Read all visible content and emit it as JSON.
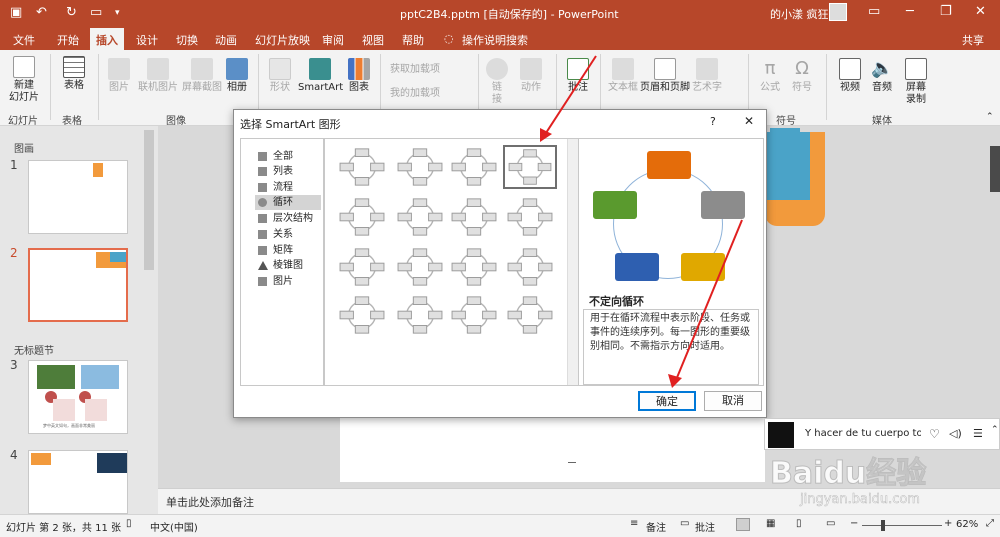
{
  "window": {
    "title": "pptC2B4.pptm [自动保存的] - PowerPoint",
    "user": "的小漾 疯狂",
    "share": "共享"
  },
  "tabs": [
    "文件",
    "开始",
    "插入",
    "设计",
    "切换",
    "动画",
    "幻灯片放映",
    "审阅",
    "视图",
    "帮助"
  ],
  "active_tab": "插入",
  "tell_me": "操作说明搜索",
  "ribbon": {
    "new_slide": [
      "新建",
      "幻灯片"
    ],
    "table": "表格",
    "picture": "图片",
    "online_picture": "联机图片",
    "screenshot": "屏幕截图",
    "album": "相册",
    "shapes": "形状",
    "smartart": "SmartArt",
    "chart": "图表",
    "get_addins": "获取加载项",
    "my_addins": "我的加载项",
    "link": "链",
    "link2": "接",
    "action": "动作",
    "comment": "批注",
    "textbox": "文本框",
    "header_footer": "页眉和页脚",
    "wordart": "艺术字",
    "equation": "公式",
    "symbol": "符号",
    "video": "视频",
    "audio": "音频",
    "screen_record": [
      "屏幕",
      "录制"
    ],
    "groups": {
      "slides": "幻灯片",
      "tables": "表格",
      "images": "图像",
      "comments": "批注",
      "symbols": "符号",
      "media": "媒体"
    }
  },
  "slides_pane": {
    "section1": "图画",
    "section2": "无标题节",
    "slide_numbers": [
      "1",
      "2",
      "3",
      "4"
    ],
    "thumb3_caption": "梦中英文如句，画面非常美丽"
  },
  "notes_placeholder": "单击此处添加备注",
  "status": {
    "slide_info": "幻灯片 第 2 张，共 11 张",
    "language": "中文(中国)",
    "notes": "备注",
    "comments": "批注",
    "zoom": "62%"
  },
  "dialog": {
    "title": "选择 SmartArt 图形",
    "help": "?",
    "close": "✕",
    "categories": [
      "全部",
      "列表",
      "流程",
      "循环",
      "层次结构",
      "关系",
      "矩阵",
      "棱锥图",
      "图片"
    ],
    "selected_category": "循环",
    "preview_title": "不定向循环",
    "preview_desc": "用于在循环流程中表示阶段、任务或事件的连续序列。每一图形的重要级别相同。不需指示方向时适用。",
    "ok": "确定",
    "cancel": "取消"
  },
  "popup": {
    "song": "Y hacer de tu cuerpo tod"
  },
  "watermark": {
    "brand": "Baidu经验",
    "url": "jingyan.baidu.com"
  },
  "colors": {
    "accent": "#b7472a",
    "preview_orange": "#e46c0a",
    "preview_gray": "#8c8c8c",
    "preview_yellow": "#e0a800",
    "preview_blue": "#2e5fb0",
    "preview_green": "#5a9a2e",
    "arrow_red": "#e02020"
  }
}
